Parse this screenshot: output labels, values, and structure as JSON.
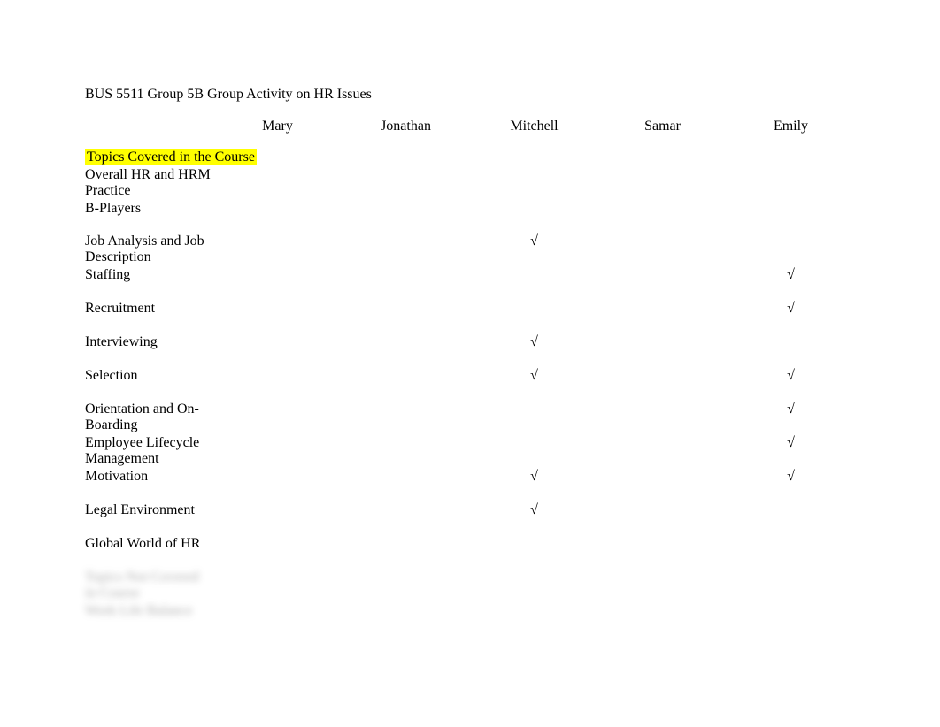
{
  "title": "BUS 5511 Group 5B Group Activity on HR Issues",
  "check": "√",
  "headers": {
    "col0": "",
    "col1": "Mary",
    "col2": "Jonathan",
    "col3": "Mitchell",
    "col4": "Samar",
    "col5": "Emily"
  },
  "section1": {
    "heading": "Topics Covered in the Course",
    "rows": [
      {
        "label": "Overall HR and HRM Practice",
        "mary": "",
        "jonathan": "",
        "mitchell": "",
        "samar": "",
        "emily": ""
      },
      {
        "label": "B-Players",
        "mary": "",
        "jonathan": "",
        "mitchell": "",
        "samar": "",
        "emily": ""
      },
      {
        "label": "Job Analysis and Job Description",
        "mary": "",
        "jonathan": "",
        "mitchell": "√",
        "samar": "",
        "emily": ""
      },
      {
        "label": "Staffing",
        "mary": "",
        "jonathan": "",
        "mitchell": "",
        "samar": "",
        "emily": "√"
      },
      {
        "label": "Recruitment",
        "mary": "",
        "jonathan": "",
        "mitchell": "",
        "samar": "",
        "emily": "√"
      },
      {
        "label": "Interviewing",
        "mary": "",
        "jonathan": "",
        "mitchell": "√",
        "samar": "",
        "emily": ""
      },
      {
        "label": "Selection",
        "mary": "",
        "jonathan": "",
        "mitchell": "√",
        "samar": "",
        "emily": "√"
      },
      {
        "label": "Orientation and On-Boarding",
        "mary": "",
        "jonathan": "",
        "mitchell": "",
        "samar": "",
        "emily": "√"
      },
      {
        "label": "Employee Lifecycle Management",
        "mary": "",
        "jonathan": "",
        "mitchell": "",
        "samar": "",
        "emily": "√"
      },
      {
        "label": "Motivation",
        "mary": "",
        "jonathan": "",
        "mitchell": "√",
        "samar": "",
        "emily": "√"
      },
      {
        "label": "Legal Environment",
        "mary": "",
        "jonathan": "",
        "mitchell": "√",
        "samar": "",
        "emily": ""
      },
      {
        "label": "Global World of HR",
        "mary": "",
        "jonathan": "",
        "mitchell": "",
        "samar": "",
        "emily": ""
      }
    ]
  },
  "blurred_rows": [
    {
      "label": "Topics Not Covered in Course"
    },
    {
      "label": "Work Life Balance"
    }
  ]
}
